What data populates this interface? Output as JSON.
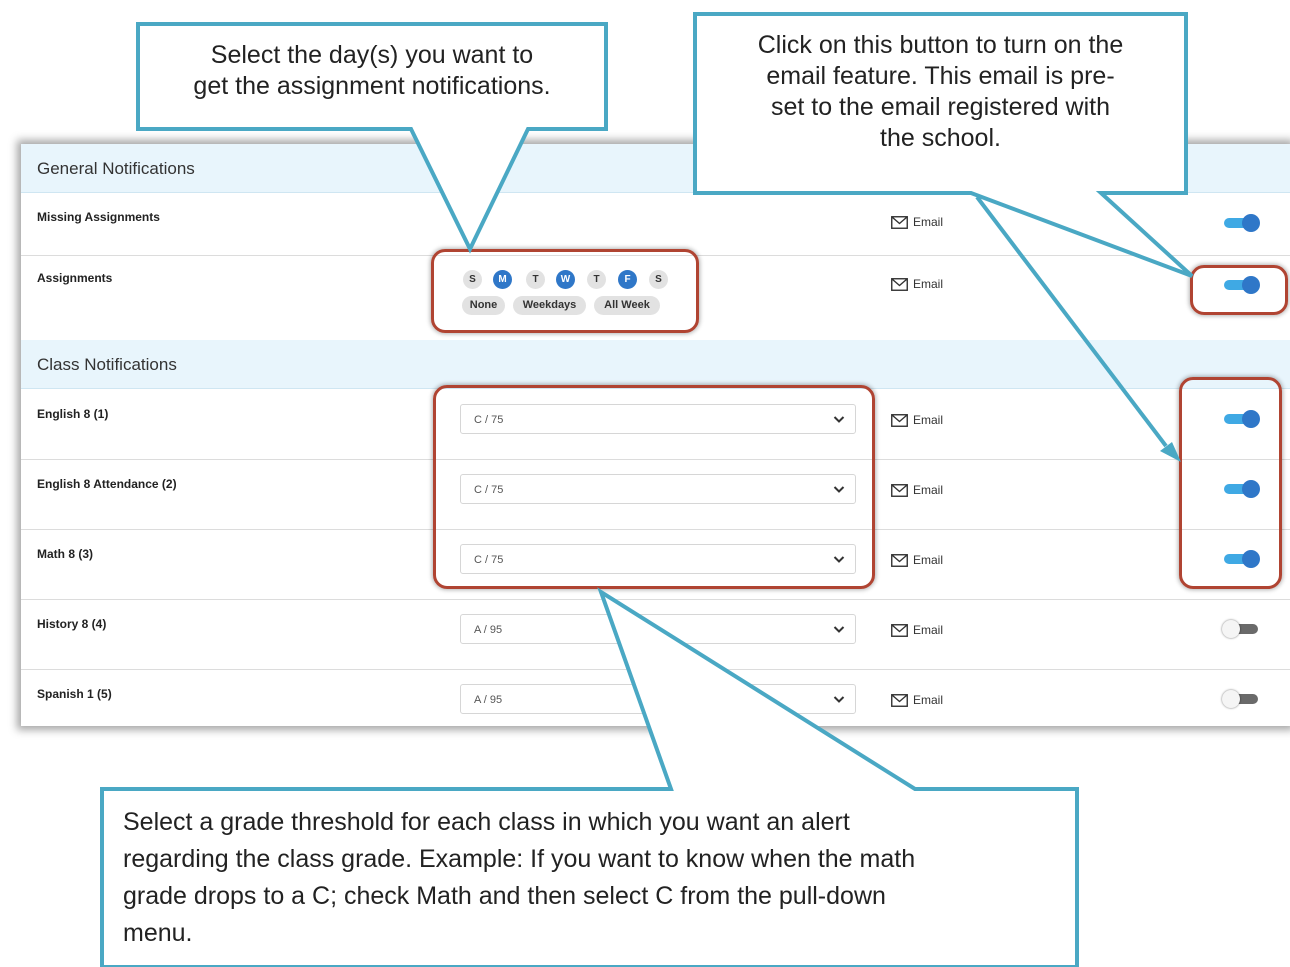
{
  "general": {
    "header": "General Notifications",
    "rows": [
      {
        "label": "Missing Assignments",
        "email": "Email",
        "toggle": "on"
      },
      {
        "label": "Assignments",
        "email": "Email",
        "toggle": "on"
      }
    ],
    "days": [
      {
        "letter": "S",
        "selected": false
      },
      {
        "letter": "M",
        "selected": true
      },
      {
        "letter": "T",
        "selected": false
      },
      {
        "letter": "W",
        "selected": true
      },
      {
        "letter": "T",
        "selected": false
      },
      {
        "letter": "F",
        "selected": true
      },
      {
        "letter": "S",
        "selected": false
      }
    ],
    "presets": [
      "None",
      "Weekdays",
      "All Week"
    ]
  },
  "classes": {
    "header": "Class Notifications",
    "rows": [
      {
        "label": "English 8 (1)",
        "threshold": "C / 75",
        "email": "Email",
        "toggle": "on"
      },
      {
        "label": "English 8 Attendance (2)",
        "threshold": "C / 75",
        "email": "Email",
        "toggle": "on"
      },
      {
        "label": "Math 8 (3)",
        "threshold": "C / 75",
        "email": "Email",
        "toggle": "on"
      },
      {
        "label": "History 8 (4)",
        "threshold": "A / 95",
        "email": "Email",
        "toggle": "off"
      },
      {
        "label": "Spanish 1 (5)",
        "threshold": "A / 95",
        "email": "Email",
        "toggle": "off"
      }
    ]
  },
  "callouts": {
    "days": [
      "Select the day(s) you want to",
      "get the assignment notifications."
    ],
    "email": [
      "Click on this button to turn on the",
      "email feature. This email is pre-",
      "set to the email registered with",
      "the school."
    ],
    "grade": [
      "Select a grade threshold for each class in which you want an alert",
      "regarding the class grade. Example: If you want to know when the math",
      "grade drops to a C; check Math and then select C from the pull-down",
      "menu."
    ]
  },
  "colors": {
    "accent_blue": "#2f77c8",
    "toggle_track_on": "#3fa9e4",
    "section_header_bg": "#e8f5fc",
    "highlight_red": "#b04432",
    "callout_border": "#4aa8c4"
  }
}
